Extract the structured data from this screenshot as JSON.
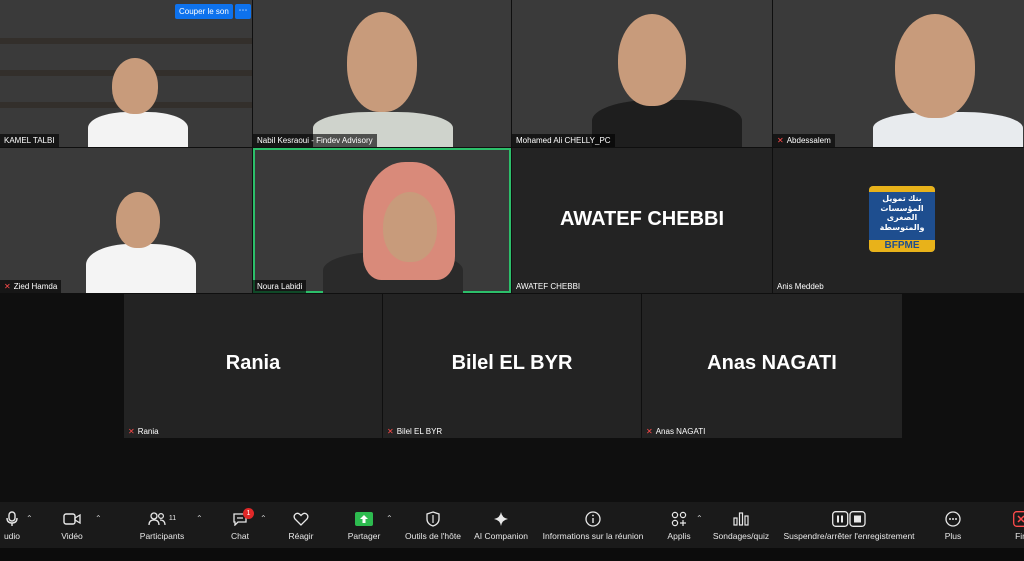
{
  "overlay": {
    "cut_sound": "Couper le son",
    "more": "⋯"
  },
  "participants": [
    {
      "name": "KAMEL TALBI"
    },
    {
      "name": "Nabil Kesraoui - Findev Advisory"
    },
    {
      "name": "Mohamed Ali CHELLY_PC"
    },
    {
      "name": "Abdessalem"
    },
    {
      "name": "Zied Hamda"
    },
    {
      "name": "Noura Labidi"
    },
    {
      "name": "AWATEF CHEBBI",
      "display": "AWATEF CHEBBI"
    },
    {
      "name": "Anis Meddeb",
      "logo": [
        "بنك تمويل",
        "المؤسسات",
        "الصغرى",
        "والمتوسطة",
        "BFPME"
      ]
    },
    {
      "name": "Rania",
      "display": "Rania"
    },
    {
      "name": "Bilel EL BYR",
      "display": "Bilel EL BYR"
    },
    {
      "name": "Anas NAGATI",
      "display": "Anas NAGATI"
    }
  ],
  "toolbar": {
    "audio": "udio",
    "video": "Vidéo",
    "participants": "Participants",
    "participants_count": "11",
    "chat": "Chat",
    "chat_badge": "1",
    "react": "Réagir",
    "share": "Partager",
    "host_tools": "Outils de l'hôte",
    "ai_companion": "AI Companion",
    "meeting_info": "Informations sur la réunion",
    "apps": "Applis",
    "polls": "Sondages/quiz",
    "recording": "Suspendre/arrêter l'enregistrement",
    "more": "Plus",
    "end": "Fin"
  },
  "colors": {
    "accent_blue": "#0e72ed",
    "active_speaker": "#2cbf6a",
    "share_green": "#2dbb4f",
    "mute_red": "#ff4b4b"
  }
}
